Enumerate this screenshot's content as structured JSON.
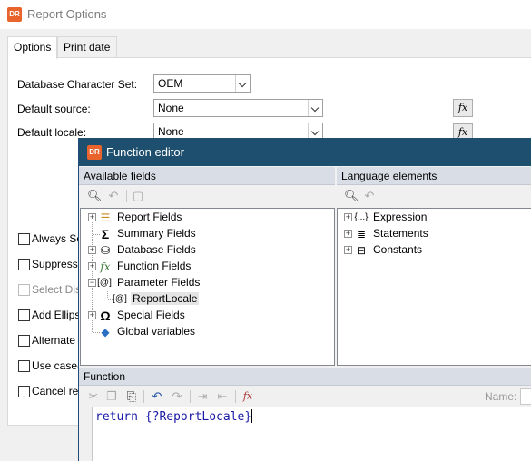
{
  "report_options": {
    "title": "Report Options",
    "logo_text": "DR",
    "tabs": [
      {
        "label": "Options",
        "active": true
      },
      {
        "label": "Print date",
        "active": false
      }
    ],
    "fields": {
      "charset_label": "Database Character Set:",
      "charset_value": "OEM",
      "default_source_label": "Default source:",
      "default_source_value": "None",
      "default_locale_label": "Default locale:",
      "default_locale_value": "None",
      "fx_label": "fx"
    },
    "checkboxes": [
      {
        "label": "Always So",
        "checked": false,
        "enabled": true
      },
      {
        "label": "Suppress",
        "checked": false,
        "enabled": true
      },
      {
        "label": "Select Dis",
        "checked": false,
        "enabled": false
      },
      {
        "label": "Add Ellips",
        "checked": false,
        "enabled": true
      },
      {
        "label": "Alternate",
        "checked": false,
        "enabled": true
      },
      {
        "label": "Use case-",
        "checked": false,
        "enabled": true
      },
      {
        "label": "Cancel re",
        "checked": false,
        "enabled": true
      }
    ]
  },
  "function_editor": {
    "title": "Function editor",
    "logo_text": "DR",
    "available_fields": {
      "header": "Available fields",
      "tree": [
        {
          "label": "Report Fields",
          "icon": "report-fields-icon",
          "expandable": true
        },
        {
          "label": "Summary Fields",
          "icon": "sigma-icon",
          "expandable": false
        },
        {
          "label": "Database Fields",
          "icon": "database-icon",
          "expandable": true
        },
        {
          "label": "Function Fields",
          "icon": "fx-icon",
          "expandable": true
        },
        {
          "label": "Parameter Fields",
          "icon": "parameter-icon",
          "expandable": true,
          "expanded": true
        },
        {
          "label": "ReportLocale",
          "icon": "parameter-icon",
          "expandable": false,
          "child": true,
          "selected": true
        },
        {
          "label": "Special Fields",
          "icon": "omega-icon",
          "expandable": true
        },
        {
          "label": "Global variables",
          "icon": "cube-icon",
          "expandable": false
        }
      ]
    },
    "language_elements": {
      "header": "Language elements",
      "tree": [
        {
          "label": "Expression",
          "icon": "braces-icon"
        },
        {
          "label": "Statements",
          "icon": "statements-icon"
        },
        {
          "label": "Constants",
          "icon": "constants-icon"
        }
      ]
    },
    "function": {
      "header": "Function",
      "name_label": "Name:",
      "code": "return {?ReportLocale}"
    }
  },
  "colors": {
    "editor_title_bar": "#1e4f6e",
    "logo": "#e8642c",
    "code_text": "#1a1aa6",
    "pane_header": "#d9dde6"
  }
}
